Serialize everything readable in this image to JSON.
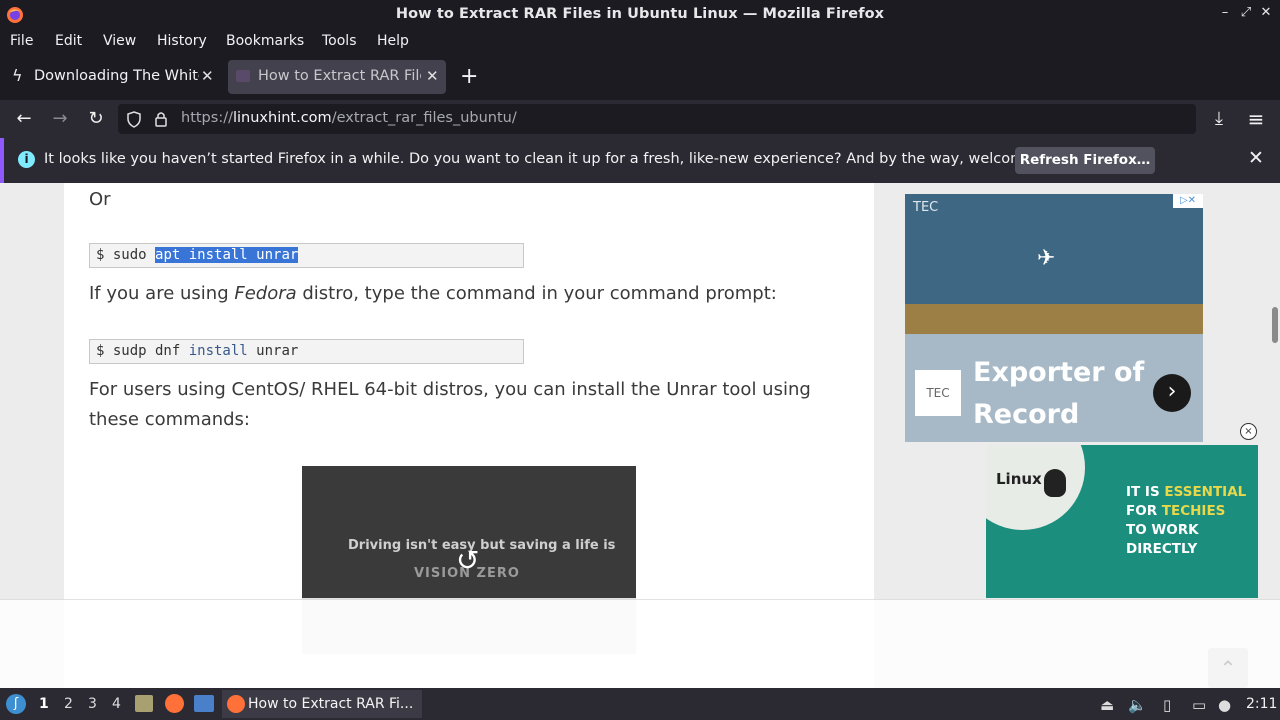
{
  "window": {
    "title": "How to Extract RAR Files in Ubuntu Linux — Mozilla Firefox",
    "minimize": "–",
    "maximize": "⤢",
    "close": "✕"
  },
  "menu": [
    "File",
    "Edit",
    "View",
    "History",
    "Bookmarks",
    "Tools",
    "Help"
  ],
  "tabs": [
    {
      "label": "Downloading The White H",
      "active": false,
      "close": "✕"
    },
    {
      "label": "How to Extract RAR Files",
      "active": true,
      "close": "✕"
    }
  ],
  "new_tab": "+",
  "nav": {
    "back": "←",
    "forward": "→",
    "reload": "↻",
    "url_prefix": "https://",
    "url_domain": "linuxhint.com",
    "url_path": "/extract_rar_files_ubuntu/",
    "reader": "▤",
    "bookmark": "☆",
    "downloads": "⤓",
    "menu": "≡"
  },
  "notification": {
    "icon": "i",
    "message": "It looks like you haven’t started Firefox in a while. Do you want to clean it up for a fresh, like-new experience? And by the way, welcome back!",
    "button": "Refresh Firefox…",
    "close": "✕"
  },
  "article": {
    "or_text": "Or",
    "code1": {
      "prompt": "$ sudo ",
      "selected": "apt install unrar"
    },
    "fedora_pre": "If you are using ",
    "fedora_em": "Fedora",
    "fedora_post": " distro, type the command in your command prompt:",
    "code2": {
      "prompt": "$ sudp dnf ",
      "kw": "install",
      "rest": " unrar"
    },
    "centos_line1": "For users using CentOS/ RHEL 64-bit distros, you can install the Unrar tool using",
    "centos_line2": "these commands:"
  },
  "video_ad": {
    "caption": "Driving isn't easy but saving a life is",
    "sub": "VISION ZERO",
    "replay": "↺"
  },
  "sidebar_ad": {
    "brand": "TEC",
    "headline1": "Exporter of",
    "headline2": "Record",
    "logo": "TEC",
    "arrow": "›",
    "choices": "▷✕",
    "close": "×"
  },
  "linux_ad": {
    "logo": "Linux",
    "line1_a": "IT IS ",
    "line1_b": "ESSENTIAL",
    "line2_a": "FOR ",
    "line2_b": "TECHIES",
    "line3": "TO WORK DIRECTLY"
  },
  "scroll_top": "⌃",
  "taskbar": {
    "workspaces": [
      "1",
      "2",
      "3",
      "4"
    ],
    "active_task": "How to Extract RAR Fi...",
    "clock": "2:11"
  }
}
